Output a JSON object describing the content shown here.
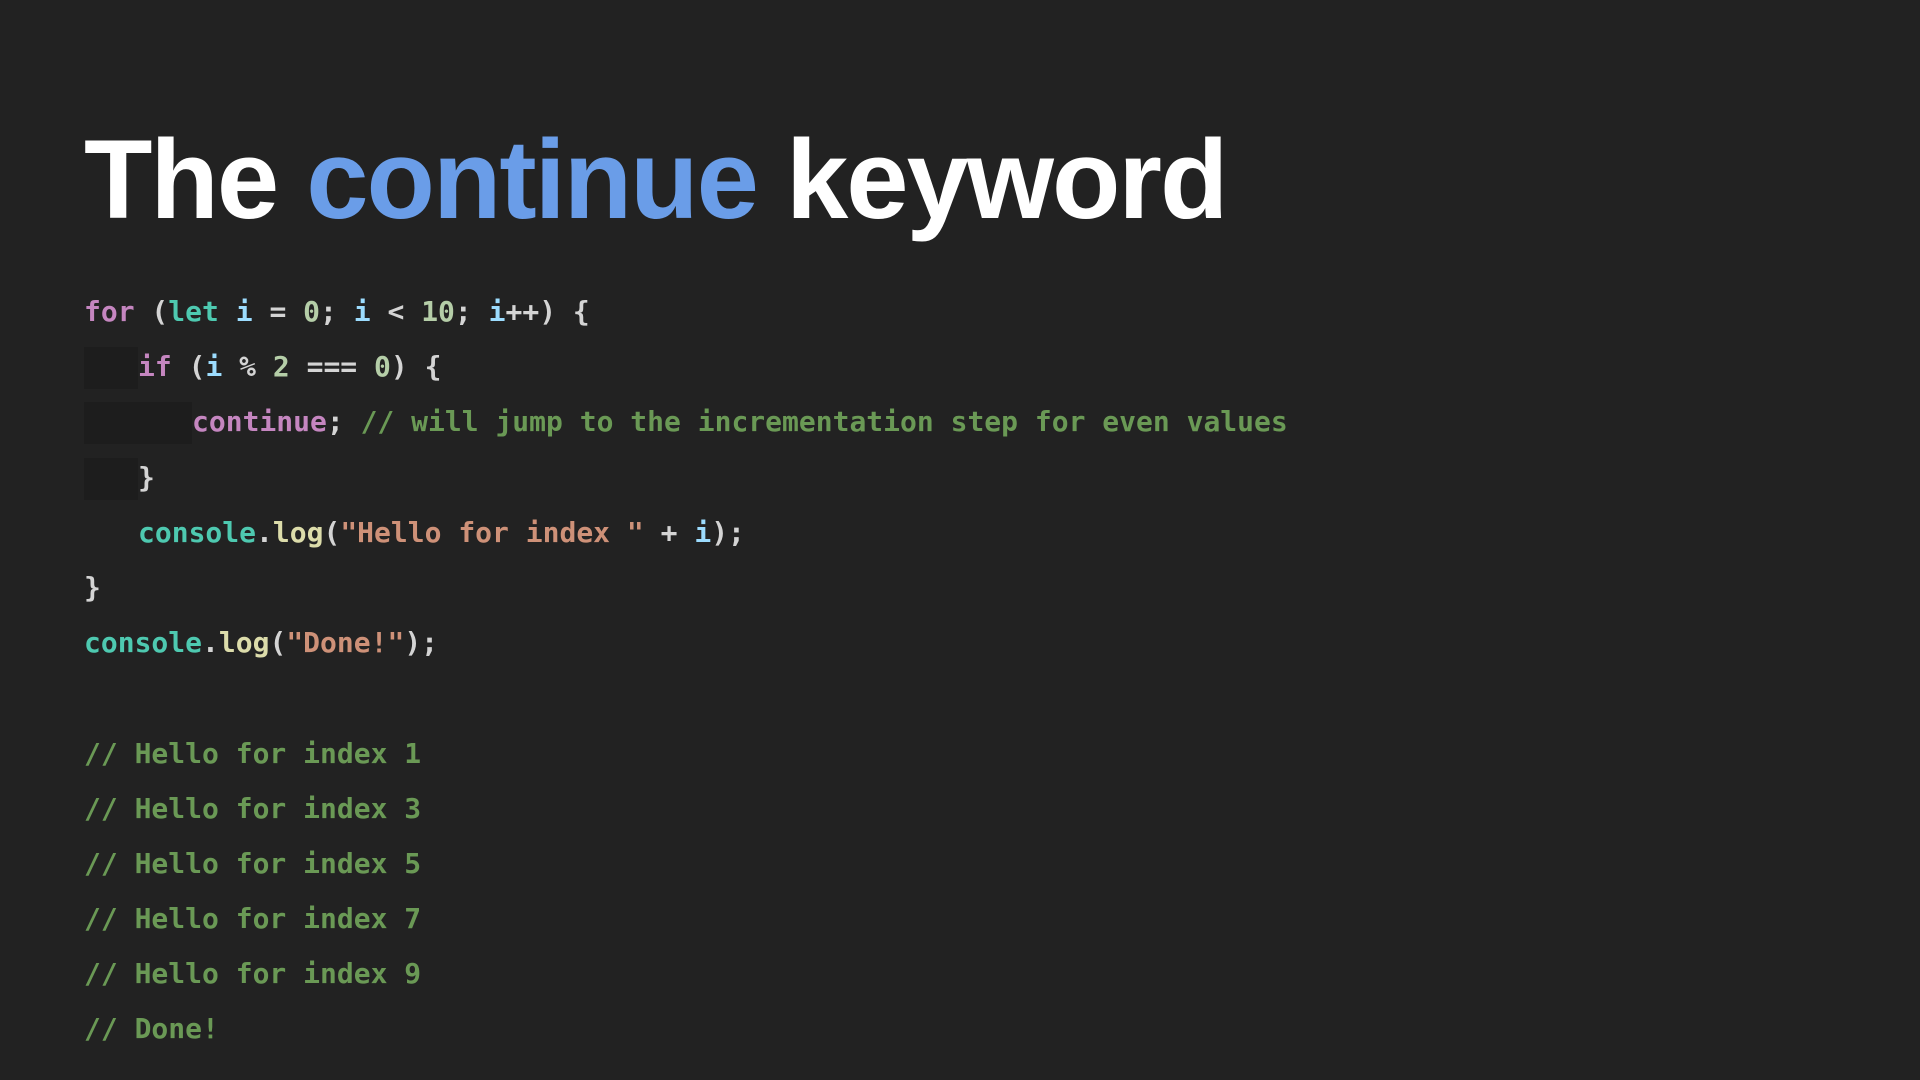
{
  "title": {
    "before": "The ",
    "keyword": "continue",
    "after": " keyword"
  },
  "code": {
    "line1": {
      "kw_for": "for",
      "p1": " (",
      "kw_let": "let",
      "sp1": " ",
      "v_i1": "i",
      "p2": " = ",
      "n_0": "0",
      "p3": "; ",
      "v_i2": "i",
      "p4": " < ",
      "n_10": "10",
      "p5": "; ",
      "v_i3": "i",
      "p6": "++) {"
    },
    "line2": {
      "kw_if": "if",
      "p1": " (",
      "v_i": "i",
      "p2": " % ",
      "n_2": "2",
      "p3": " === ",
      "n_0": "0",
      "p4": ") {"
    },
    "line3": {
      "kw_continue": "continue",
      "p1": "; ",
      "comment": "// will jump to the incrementation step for even values"
    },
    "line4": {
      "close": "}"
    },
    "line5": {
      "obj": "console",
      "dot": ".",
      "fn": "log",
      "p1": "(",
      "str": "\"Hello for index \"",
      "p2": " + ",
      "v_i": "i",
      "p3": ");"
    },
    "line6": {
      "close": "}"
    },
    "line7": {
      "obj": "console",
      "dot": ".",
      "fn": "log",
      "p1": "(",
      "str": "\"Done!\"",
      "p2": ");"
    },
    "output": [
      "// Hello for index 1",
      "// Hello for index 3",
      "// Hello for index 5",
      "// Hello for index 7",
      "// Hello for index 9",
      "// Done!"
    ]
  },
  "colors": {
    "background": "#222222",
    "title_text": "#ffffff",
    "title_keyword": "#6a9de8",
    "keyword": "#c586c0",
    "declaration": "#4ec9b0",
    "variable": "#9cdcfe",
    "number": "#b5cea8",
    "comment": "#6a9955",
    "function": "#dcdcaa",
    "string": "#ce9178"
  }
}
